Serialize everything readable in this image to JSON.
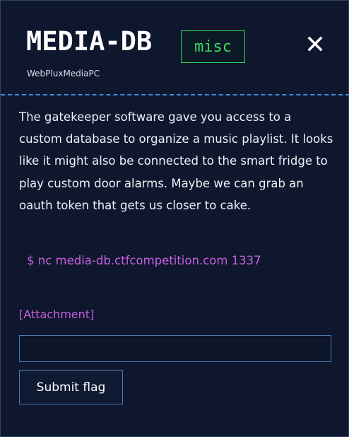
{
  "challenge": {
    "title": "MEDIA-DB",
    "category": "misc",
    "author": "WebPluxMediaPC",
    "description": "The gatekeeper software gave you access to a custom database to organize a music playlist. It looks like it might also be connected to the smart fridge to play custom door alarms. Maybe we can grab an oauth token that gets us closer to cake.",
    "command": "$ nc media-db.ctfcompetition.com 1337",
    "attachment_label": "[Attachment]"
  },
  "form": {
    "flag_placeholder": "",
    "flag_value": "",
    "submit_label": "Submit flag"
  },
  "icons": {
    "close": "close-icon"
  },
  "colors": {
    "background": "#0f1830",
    "badge_green": "#39d864",
    "accent_purple": "#c95ee0",
    "divider_blue": "#3b8fe0",
    "input_border": "#4a7cb0"
  }
}
